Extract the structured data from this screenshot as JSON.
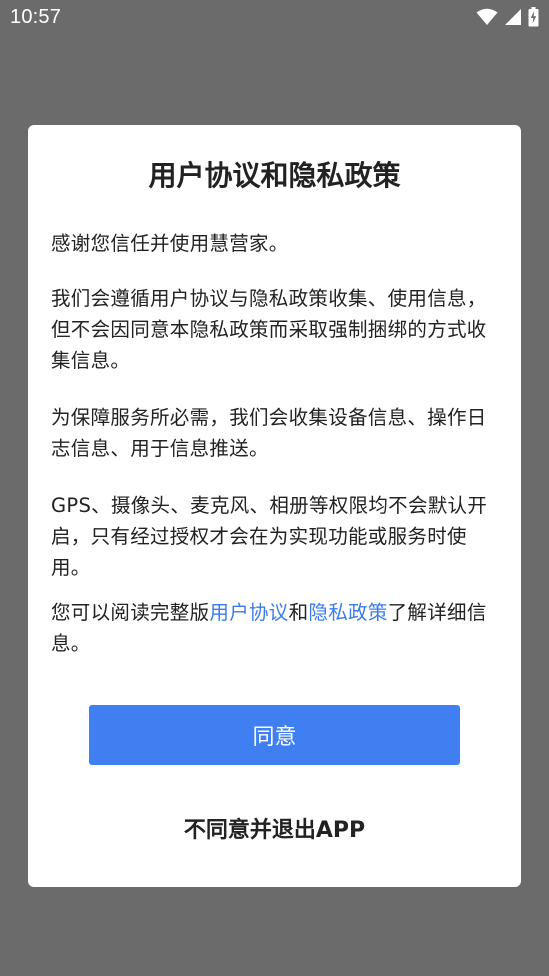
{
  "status_bar": {
    "time": "10:57",
    "icons": [
      "wifi-icon",
      "signal-icon",
      "battery-charging-icon"
    ]
  },
  "dialog": {
    "title": "用户协议和隐私政策",
    "p1": "感谢您信任并使用慧营家。",
    "p2": "我们会遵循用户协议与隐私政策收集、使用信息，但不会因同意本隐私政策而采取强制捆绑的方式收集信息。",
    "p3": "为保障服务所必需，我们会收集设备信息、操作日志信息、用于信息推送。",
    "p4": "GPS、摄像头、麦克风、相册等权限均不会默认开启，只有经过授权才会在为实现功能或服务时使用。",
    "p5": {
      "before": "您可以阅读完整版",
      "link_agreement": "用户协议",
      "and": "和",
      "link_privacy": "隐私政策",
      "after": "了解详细信息。"
    },
    "agree_label": "同意",
    "disagree_label": "不同意并退出APP"
  },
  "colors": {
    "overlay": "#6b6b6b",
    "primary": "#3f7ff2",
    "link": "#3a7bf0",
    "text": "#222222"
  }
}
